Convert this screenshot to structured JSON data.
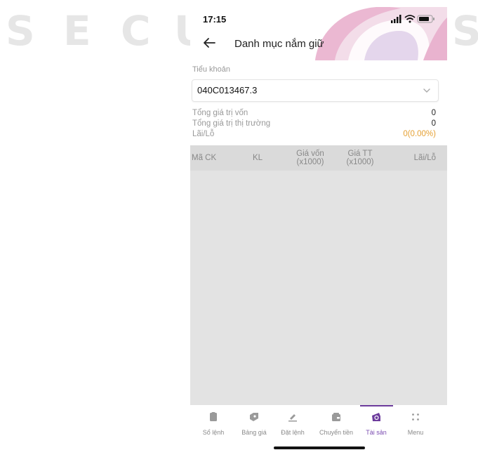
{
  "watermark": {
    "letters": [
      "S",
      "E",
      "C",
      "U",
      "S"
    ]
  },
  "status_bar": {
    "time": "17:15",
    "icons": [
      "signal-icon",
      "wifi-icon",
      "battery-icon"
    ]
  },
  "header": {
    "title": "Danh mục nắm giữ",
    "back_icon": "back-arrow-icon"
  },
  "account": {
    "label": "Tiểu khoản",
    "value": "040C013467.3",
    "chevron_icon": "chevron-down-icon"
  },
  "summary": {
    "cost_label": "Tổng giá trị vốn",
    "cost_value": "0",
    "market_label": "Tổng giá trị thị trường",
    "market_value": "0",
    "pl_label": "Lãi/Lỗ",
    "pl_value": "0(0.00%)"
  },
  "table": {
    "columns": [
      {
        "line1": "Mã CK",
        "line2": ""
      },
      {
        "line1": "KL",
        "line2": ""
      },
      {
        "line1": "Giá vốn",
        "line2": "(x1000)"
      },
      {
        "line1": "Giá TT",
        "line2": "(x1000)"
      },
      {
        "line1": "Lãi/Lỗ",
        "line2": ""
      }
    ],
    "rows": []
  },
  "tabbar": {
    "items": [
      {
        "label": "Sổ lệnh",
        "icon": "order-book-icon",
        "active": false
      },
      {
        "label": "Bảng giá",
        "icon": "price-board-icon",
        "active": false
      },
      {
        "label": "Đặt lệnh",
        "icon": "place-order-icon",
        "active": false
      },
      {
        "label": "Chuyển tiền",
        "icon": "transfer-icon",
        "active": false
      },
      {
        "label": "Tài sản",
        "icon": "assets-icon",
        "active": true
      },
      {
        "label": "Menu",
        "icon": "menu-grid-icon",
        "active": false
      }
    ]
  },
  "colors": {
    "accent": "#6c3b9c",
    "profit_loss": "#e5a033",
    "table_bg": "#e3e3e3",
    "label_gray": "#999999"
  }
}
